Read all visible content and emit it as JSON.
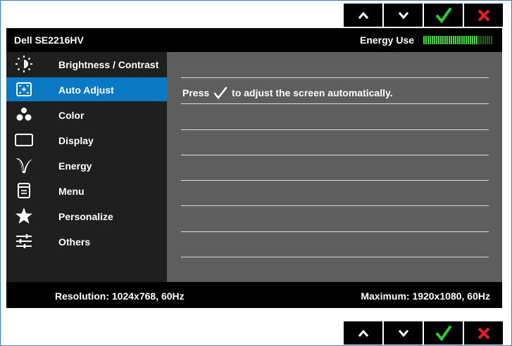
{
  "nav_buttons": {
    "up_icon": "caret-up-icon",
    "down_icon": "caret-down-icon",
    "ok_icon": "check-icon",
    "exit_icon": "close-icon",
    "ok_color": "#2ecc2e",
    "exit_color": "#e02020"
  },
  "header": {
    "model": "Dell SE2216HV",
    "energy_label": "Energy Use",
    "energy_level": 0.8
  },
  "menu": {
    "active_index": 1,
    "items": [
      {
        "label": "Brightness / Contrast",
        "icon": "brightness-icon"
      },
      {
        "label": "Auto Adjust",
        "icon": "auto-adjust-icon"
      },
      {
        "label": "Color",
        "icon": "color-dots-icon"
      },
      {
        "label": "Display",
        "icon": "display-icon"
      },
      {
        "label": "Energy",
        "icon": "leaf-icon"
      },
      {
        "label": "Menu",
        "icon": "menu-icon"
      },
      {
        "label": "Personalize",
        "icon": "star-icon"
      },
      {
        "label": "Others",
        "icon": "sliders-icon"
      }
    ]
  },
  "content": {
    "press_label": "Press",
    "instruction": "to adjust the screen automatically."
  },
  "footer": {
    "resolution": "Resolution: 1024x768, 60Hz",
    "maximum": "Maximum: 1920x1080, 60Hz"
  },
  "colors": {
    "accent": "#0a79c3",
    "menu_bg": "#1f1f1f",
    "content_bg": "#5e5e5e",
    "energy_on": "#33dd33",
    "energy_off": "#1f5f1f"
  }
}
